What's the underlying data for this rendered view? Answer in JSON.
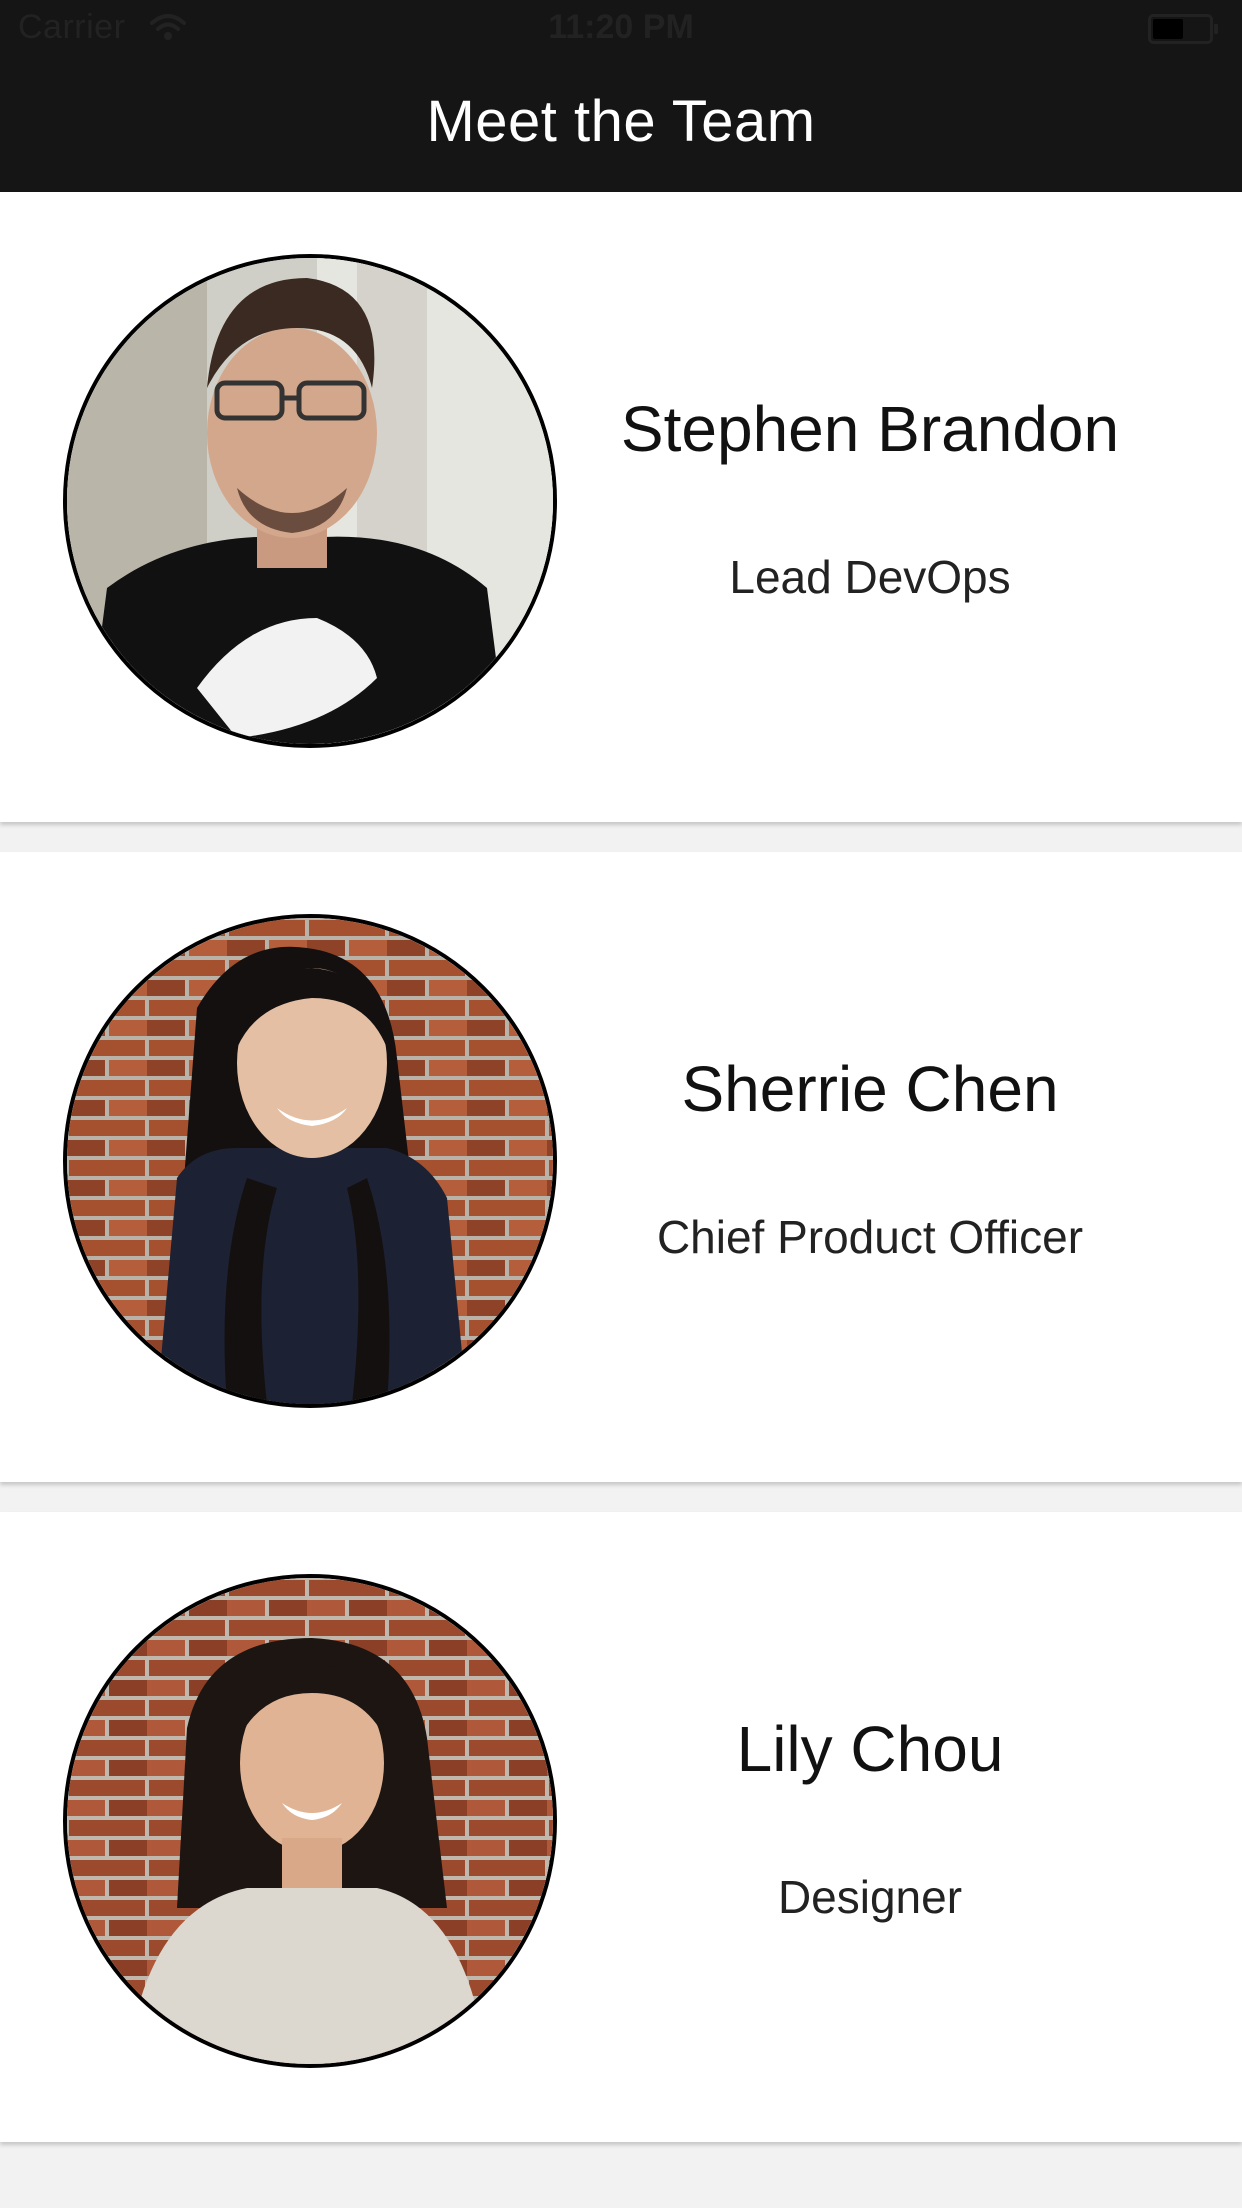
{
  "status_bar": {
    "carrier": "Carrier",
    "time": "11:20 PM",
    "wifi_icon": "wifi-icon",
    "battery_icon": "battery-icon"
  },
  "nav": {
    "title": "Meet the Team"
  },
  "team": [
    {
      "name": "Stephen Brandon",
      "role": "Lead DevOps",
      "avatar_icon": "avatar-photo"
    },
    {
      "name": "Sherrie Chen",
      "role": "Chief Product Officer",
      "avatar_icon": "avatar-photo"
    },
    {
      "name": "Lily Chou",
      "role": "Designer",
      "avatar_icon": "avatar-photo"
    }
  ],
  "colors": {
    "nav_background": "#151515",
    "nav_title": "#ffffff",
    "card_background": "#ffffff",
    "page_background": "#f2f2f2",
    "avatar_border": "#000000"
  }
}
